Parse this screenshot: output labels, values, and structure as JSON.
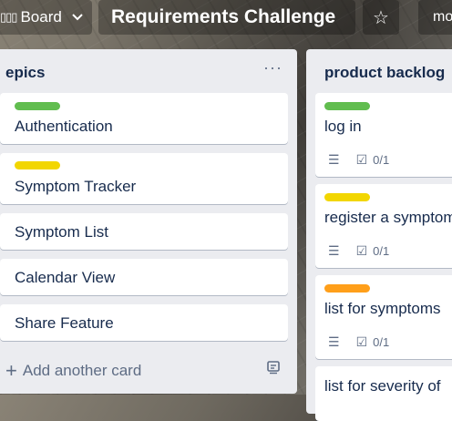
{
  "header": {
    "board_switcher_label": "Board",
    "board_switcher_icon": "board-icon",
    "board_title": "Requirements Challenge",
    "star_icon": "star-icon",
    "member_label": "mo"
  },
  "lists": [
    {
      "title": "epics",
      "menu": "···",
      "cards": [
        {
          "label_color": "#61bd4f",
          "text": "Authentication"
        },
        {
          "label_color": "#f2d600",
          "text": "Symptom Tracker"
        },
        {
          "label_color": null,
          "text": "Symptom List"
        },
        {
          "label_color": null,
          "text": "Calendar View"
        },
        {
          "label_color": null,
          "text": "Share Feature"
        }
      ],
      "add_card": "Add another card"
    },
    {
      "title": "product backlog",
      "cards": [
        {
          "label_color": "#61bd4f",
          "text": "log in",
          "checklist": "0/1"
        },
        {
          "label_color": "#f2d600",
          "text": "register a symptom",
          "checklist": "0/1"
        },
        {
          "label_color": "#ff9f1a",
          "text": "list for symptoms",
          "checklist": "0/1"
        },
        {
          "label_color": null,
          "text": "list for severity of"
        }
      ]
    }
  ]
}
